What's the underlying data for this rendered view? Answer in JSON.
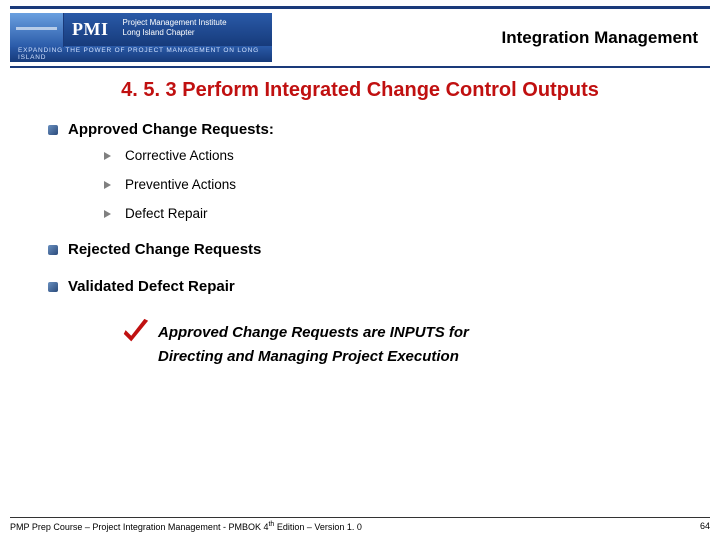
{
  "header": {
    "logo_acronym": "PMI",
    "logo_line1": "Project Management Institute",
    "logo_line2": "Long Island Chapter",
    "tagline": "EXPANDING THE POWER OF PROJECT MANAGEMENT ON LONG ISLAND",
    "title": "Integration Management"
  },
  "section_title": "4. 5. 3 Perform Integrated Change Control Outputs",
  "bullets": [
    {
      "text": "Approved Change Requests:"
    },
    {
      "text": "Rejected Change Requests"
    },
    {
      "text": "Validated Defect Repair"
    }
  ],
  "sub_bullets": [
    {
      "text": "Corrective Actions"
    },
    {
      "text": "Preventive Actions"
    },
    {
      "text": "Defect Repair"
    }
  ],
  "note_line1": "Approved Change Requests are INPUTS for",
  "note_line2": "Directing and Managing Project Execution",
  "footer": {
    "text_prefix": "PMP Prep Course – Project Integration Management - PMBOK 4",
    "text_sup": "th",
    "text_suffix": " Edition – Version 1. 0",
    "page": "64"
  }
}
